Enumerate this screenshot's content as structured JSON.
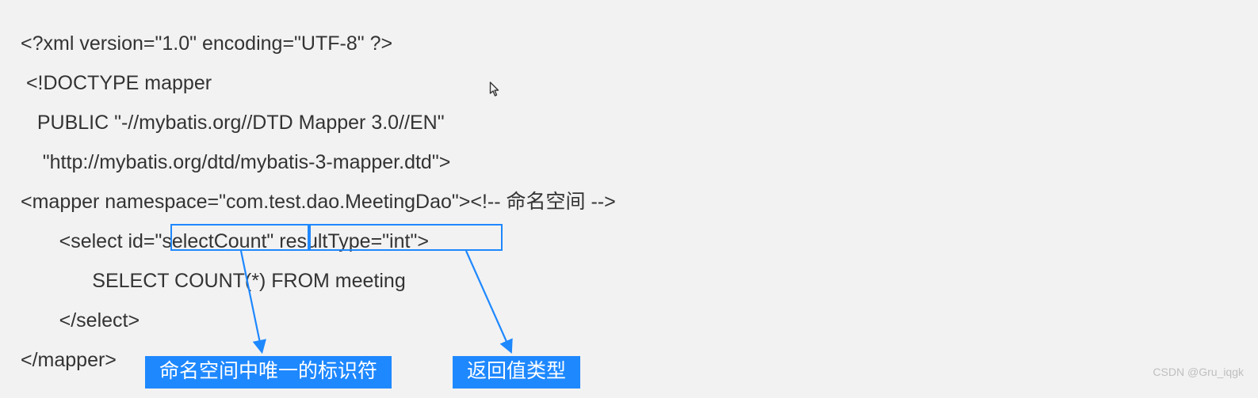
{
  "code": {
    "line1": "<?xml version=\"1.0\" encoding=\"UTF-8\" ?>",
    "line2": " <!DOCTYPE mapper",
    "line3": "   PUBLIC \"-//mybatis.org//DTD Mapper 3.0//EN\"",
    "line4": "    \"http://mybatis.org/dtd/mybatis-3-mapper.dtd\">",
    "line5": "<mapper namespace=\"com.test.dao.MeetingDao\"><!-- 命名空间 -->",
    "line6": "       <select id=\"selectCount\" resultType=\"int\">",
    "line7": "             SELECT COUNT(*) FROM meeting",
    "line8": "       </select>",
    "line9": "</mapper>"
  },
  "annotations": {
    "box1_label": "命名空间中唯一的标识符",
    "box2_label": "返回值类型"
  },
  "attribution": "CSDN @Gru_iqgk"
}
